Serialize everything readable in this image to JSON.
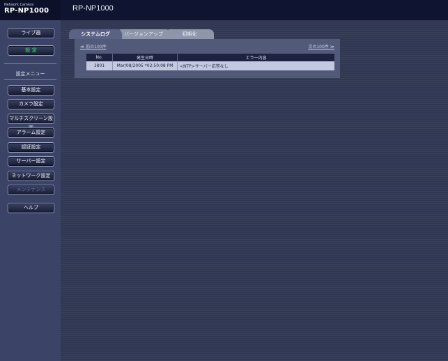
{
  "header": {
    "brand_small": "Network Camera",
    "brand_model": "RP-NP1000",
    "page_model": "RP-NP1000"
  },
  "sidebar": {
    "live_button": "ライブ画",
    "setup_button": "設 定",
    "menu_label": "設定メニュー",
    "items": [
      "基本設定",
      "カメラ設定",
      "マルチスクリーン設定",
      "アラーム設定",
      "認証設定",
      "サーバー設定",
      "ネットワーク設定",
      "メンテナンス"
    ],
    "help_button": "ヘルプ"
  },
  "tabs": [
    "システムログ",
    "バージョンアップ",
    "初期化"
  ],
  "log": {
    "prev_link": "≪ 前の100件",
    "next_link": "次の100件 ≫",
    "headers": [
      "No.",
      "発生日時",
      "エラー内容"
    ],
    "rows": [
      {
        "no": "3801",
        "datetime": "Mar/08/2005 *02:50:08 PM",
        "message": "<NTP>サーバー応答なし"
      }
    ]
  },
  "colors": {
    "background": "#2c3450",
    "sidebar": "#3b4466",
    "active_tab": "#5b6384",
    "selected_menu_green": "#3ea56a"
  }
}
